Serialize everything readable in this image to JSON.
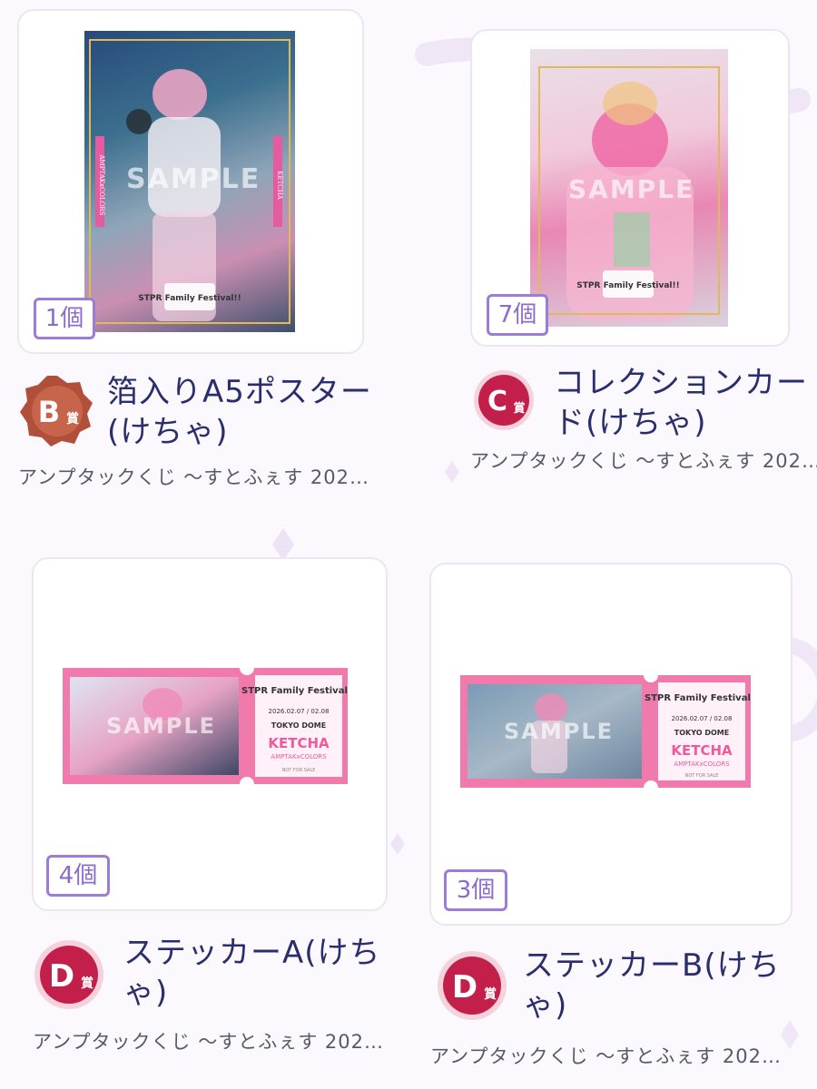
{
  "items": [
    {
      "count": "1個",
      "prize_letter": "B",
      "prize_kanji": "賞",
      "title_line1": "箔入りA5ポスター",
      "title_line2": "(けちゃ)",
      "subtitle": "アンプタックくじ 〜すとふぇす 202…",
      "sample_label": "SAMPLE",
      "art_left_text": "AMPTAKxCOLORS",
      "art_right_text": "KETCHA",
      "logo_text": "STPR Family Festival!!"
    },
    {
      "count": "7個",
      "prize_letter": "C",
      "prize_kanji": "賞",
      "title_line1": "コレクションカー",
      "title_line2": "ド(けちゃ)",
      "subtitle": "アンプタックくじ 〜すとふぇす 202…",
      "sample_label": "SAMPLE",
      "logo_text": "STPR Family Festival!!"
    },
    {
      "count": "4個",
      "prize_letter": "D",
      "prize_kanji": "賞",
      "title_line1": "ステッカーA(けち",
      "title_line2": "ゃ)",
      "subtitle": "アンプタックくじ 〜すとふぇす 202…",
      "sample_label": "SAMPLE",
      "ticket": {
        "logo": "STPR Family Festival!!",
        "date": "2026.02.07 / 02.08",
        "venue": "TOKYO DOME",
        "name": "KETCHA",
        "unit": "AMPTAKxCOLORS",
        "note": "NOT FOR SALE"
      }
    },
    {
      "count": "3個",
      "prize_letter": "D",
      "prize_kanji": "賞",
      "title_line1": "ステッカーB(けち",
      "title_line2": "ゃ)",
      "subtitle": "アンプタックくじ 〜すとふぇす 202…",
      "sample_label": "SAMPLE",
      "ticket": {
        "logo": "STPR Family Festival!!",
        "date": "2026.02.07 / 02.08",
        "venue": "TOKYO DOME",
        "name": "KETCHA",
        "unit": "AMPTAKxCOLORS",
        "note": "NOT FOR SALE"
      }
    }
  ],
  "colors": {
    "badge_border": "#9b7cd6",
    "title": "#2a2e6e",
    "subtitle": "#555a6a",
    "b_prize": "#b0503a",
    "c_prize": "#c2204a",
    "d_prize": "#c2204a",
    "ticket_pink": "#f07aac"
  }
}
